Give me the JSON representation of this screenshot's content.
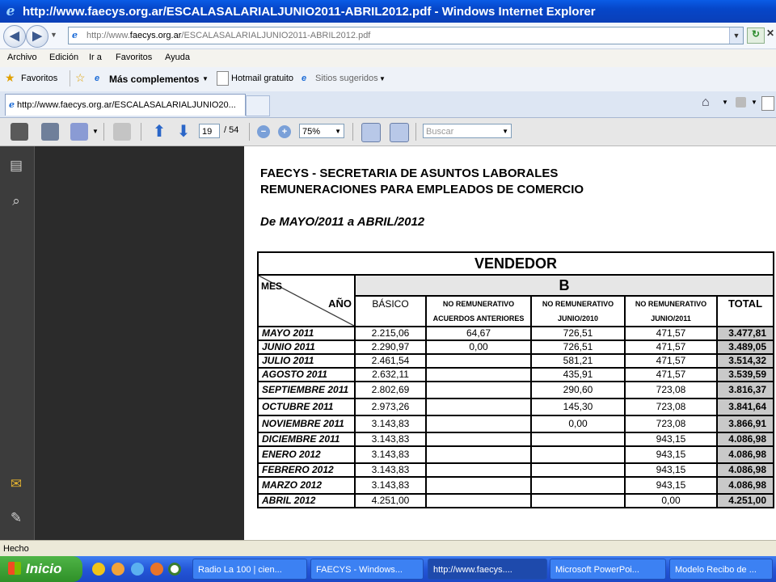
{
  "window": {
    "title": "http://www.faecys.org.ar/ESCALASALARIALJUNIO2011-ABRIL2012.pdf - Windows Internet Explorer"
  },
  "address": {
    "prefix": "http://www.",
    "domain": "faecys.org.ar",
    "path": "/ESCALASALARIALJUNIO2011-ABRIL2012.pdf"
  },
  "menu": [
    "Archivo",
    "Edición",
    "Ir a",
    "Favoritos",
    "Ayuda"
  ],
  "favbar": {
    "favoritos": "Favoritos",
    "mas": "Más complementos",
    "hotmail": "Hotmail gratuito",
    "sitios": "Sitios sugeridos"
  },
  "tab": {
    "label": "http://www.faecys.org.ar/ESCALASALARIALJUNIO20..."
  },
  "pdf_toolbar": {
    "page": "19",
    "total": "/ 54",
    "zoom": "75%",
    "search_placeholder": "Buscar"
  },
  "doc": {
    "line1": "FAECYS - SECRETARIA DE ASUNTOS LABORALES",
    "line2": "REMUNERACIONES  PARA  EMPLEADOS DE COMERCIO",
    "period": "De  MAYO/2011  a  ABRIL/2012",
    "table_title": "VENDEDOR",
    "category": "B",
    "mes": "MES",
    "anio": "AÑO",
    "headers": {
      "basico": "BÁSICO",
      "nr1a": "NO REMUNERATIVO",
      "nr1b": "ACUERDOS ANTERIORES",
      "nr2a": "NO REMUNERATIVO",
      "nr2b": "JUNIO/2010",
      "nr3a": "NO REMUNERATIVO",
      "nr3b": "JUNIO/2011",
      "total": "TOTAL"
    },
    "rows": [
      {
        "mes": "MAYO 2011",
        "basico": "2.215,06",
        "acuerdos": "64,67",
        "jun2010": "726,51",
        "jun2011": "471,57",
        "total": "3.477,81"
      },
      {
        "mes": "JUNIO 2011",
        "basico": "2.290,97",
        "acuerdos": "0,00",
        "jun2010": "726,51",
        "jun2011": "471,57",
        "total": "3.489,05"
      },
      {
        "mes": "JULIO 2011",
        "basico": "2.461,54",
        "acuerdos": "",
        "jun2010": "581,21",
        "jun2011": "471,57",
        "total": "3.514,32"
      },
      {
        "mes": "AGOSTO 2011",
        "basico": "2.632,11",
        "acuerdos": "",
        "jun2010": "435,91",
        "jun2011": "471,57",
        "total": "3.539,59"
      },
      {
        "mes": "SEPTIEMBRE 2011",
        "basico": "2.802,69",
        "acuerdos": "",
        "jun2010": "290,60",
        "jun2011": "723,08",
        "total": "3.816,37"
      },
      {
        "mes": "OCTUBRE 2011",
        "basico": "2.973,26",
        "acuerdos": "",
        "jun2010": "145,30",
        "jun2011": "723,08",
        "total": "3.841,64"
      },
      {
        "mes": "NOVIEMBRE 2011",
        "basico": "3.143,83",
        "acuerdos": "",
        "jun2010": "0,00",
        "jun2011": "723,08",
        "total": "3.866,91"
      },
      {
        "mes": "DICIEMBRE 2011",
        "basico": "3.143,83",
        "acuerdos": "",
        "jun2010": "",
        "jun2011": "943,15",
        "total": "4.086,98"
      },
      {
        "mes": "ENERO 2012",
        "basico": "3.143,83",
        "acuerdos": "",
        "jun2010": "",
        "jun2011": "943,15",
        "total": "4.086,98"
      },
      {
        "mes": "FEBRERO 2012",
        "basico": "3.143,83",
        "acuerdos": "",
        "jun2010": "",
        "jun2011": "943,15",
        "total": "4.086,98"
      },
      {
        "mes": "MARZO 2012",
        "basico": "3.143,83",
        "acuerdos": "",
        "jun2010": "",
        "jun2011": "943,15",
        "total": "4.086,98"
      },
      {
        "mes": "ABRIL  2012",
        "basico": "4.251,00",
        "acuerdos": "",
        "jun2010": "",
        "jun2011": "0,00",
        "total": "4.251,00"
      }
    ]
  },
  "status": {
    "text": "Hecho"
  },
  "taskbar": {
    "start": "Inicio",
    "tasks": [
      "Radio La 100 | cien...",
      "FAECYS - Windows...",
      "http://www.faecys....",
      "Microsoft PowerPoi...",
      "Modelo Recibo de ..."
    ]
  },
  "colors": {
    "ie_blue": "#0a5ce6",
    "taskbar": "#2456d8",
    "start_green": "#3a9d31",
    "total_cell": "#c9c9c9"
  }
}
